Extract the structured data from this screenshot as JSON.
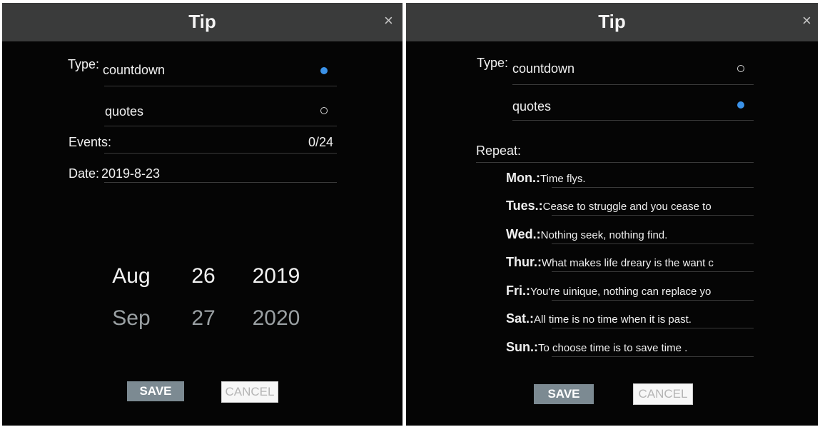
{
  "left": {
    "title": "Tip",
    "close": "×",
    "type_label": "Type:",
    "options": [
      {
        "label": "countdown",
        "selected": true
      },
      {
        "label": "quotes",
        "selected": false
      }
    ],
    "events_label": "Events:",
    "events_count": "0/24",
    "date_label": "Date:",
    "date_value": "2019-8-23",
    "picker": {
      "month": [
        "Aug",
        "Sep"
      ],
      "day": [
        "26",
        "27"
      ],
      "year": [
        "2019",
        "2020"
      ]
    },
    "save_label": "SAVE",
    "cancel_label": "CANCEL"
  },
  "right": {
    "title": "Tip",
    "close": "×",
    "type_label": "Type:",
    "options": [
      {
        "label": "countdown",
        "selected": false
      },
      {
        "label": "quotes",
        "selected": true
      }
    ],
    "repeat_label": "Repeat:",
    "days": [
      {
        "day": "Mon.:",
        "quote": "Time flys."
      },
      {
        "day": "Tues.:",
        "quote": "Cease to struggle and you cease to"
      },
      {
        "day": "Wed.:",
        "quote": "Nothing seek, nothing find."
      },
      {
        "day": "Thur.:",
        "quote": "What makes life dreary is the want c"
      },
      {
        "day": "Fri.:",
        "quote": "You're uinique, nothing can replace yo"
      },
      {
        "day": "Sat.:",
        "quote": "All time is no time when it is past."
      },
      {
        "day": "Sun.:",
        "quote": "To choose time is to save time ."
      }
    ],
    "save_label": "SAVE",
    "cancel_label": "CANCEL"
  },
  "colors": {
    "accent": "#3b92e8",
    "titlebar": "#3a3b3b",
    "background": "#050505",
    "save_button": "#7c8a92"
  },
  "icons": {
    "close": "close-icon",
    "radio_on": "radio-selected-icon",
    "radio_off": "radio-unselected-icon"
  }
}
